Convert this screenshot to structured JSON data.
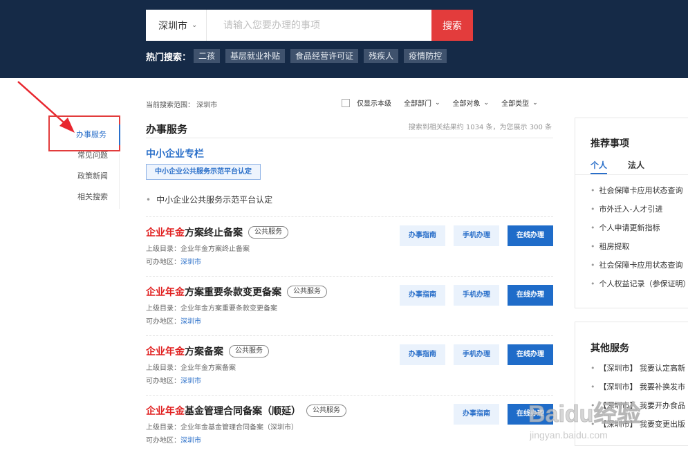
{
  "header": {
    "city": "深圳市",
    "search_placeholder": "请输入您要办理的事项",
    "search_button": "搜索",
    "hot_label": "热门搜索：",
    "hot_tags": [
      "二孩",
      "基层就业补贴",
      "食品经营许可证",
      "残疾人",
      "疫情防控"
    ]
  },
  "left_nav": {
    "items": [
      "办事服务",
      "常见问题",
      "政策新闻",
      "相关搜索"
    ]
  },
  "filters": {
    "scope_text": "当前搜索范围： 深圳市",
    "only_level": "仅显示本级",
    "dept": "全部部门",
    "target": "全部对象",
    "type": "全部类型"
  },
  "main": {
    "section_title": "办事服务",
    "result_count": "搜索到相关结果约 1034 条，为您展示 300 条",
    "sme": {
      "title": "中小企业专栏",
      "tag": "中小企业公共服务示范平台认定",
      "item": "中小企业公共服务示范平台认定"
    },
    "results": [
      {
        "title_hl": "企业年金",
        "title_rest": "方案终止备案",
        "badge": "公共服务",
        "catalog": "上级目录：企业年金方案终止备案",
        "region_label": "可办地区：",
        "region": "深圳市"
      },
      {
        "title_hl": "企业年金",
        "title_rest": "方案重要条款变更备案",
        "badge": "公共服务",
        "catalog": "上级目录：企业年金方案重要条款变更备案",
        "region_label": "可办地区：",
        "region": "深圳市"
      },
      {
        "title_hl": "企业年金",
        "title_rest": "方案备案",
        "badge": "公共服务",
        "catalog": "上级目录：企业年金方案备案",
        "region_label": "可办地区：",
        "region": "深圳市"
      },
      {
        "title_hl": "企业年金",
        "title_rest": "基金管理合同备案（顺延）",
        "badge": "公共服务",
        "catalog": "上级目录：企业年金基金管理合同备案（深圳市）",
        "region_label": "可办地区：",
        "region": "深圳市"
      }
    ],
    "buttons": {
      "guide": "办事指南",
      "mobile": "手机办理",
      "online": "在线办理"
    }
  },
  "recommend": {
    "title": "推荐事项",
    "tabs": [
      "个人",
      "法人"
    ],
    "items": [
      "社会保障卡应用状态查询",
      "市外迁入-人才引进",
      "个人申请更新指标",
      "租房提取",
      "社会保障卡应用状态查询",
      "个人权益记录（参保证明）"
    ]
  },
  "other_services": {
    "title": "其他服务",
    "items": [
      "【深圳市】 我要认定高新",
      "【深圳市】 我要补换发市",
      "【深圳市】 我要开办食品",
      "【深圳市】 我要变更出版"
    ]
  },
  "watermark": {
    "text": "Baidu经验",
    "sub": "jingyan.baidu.com"
  },
  "colors": {
    "header_bg": "#152a47",
    "accent": "#2a6fc9",
    "highlight": "#e02020"
  }
}
